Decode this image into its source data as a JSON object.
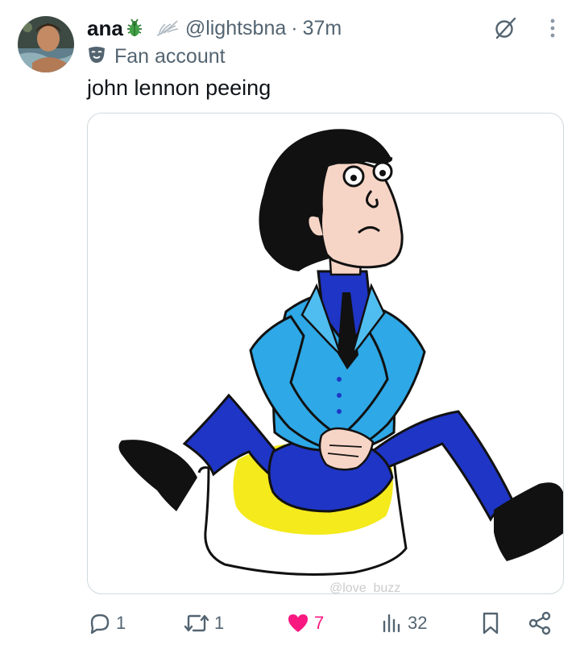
{
  "tweet": {
    "author_name": "ana",
    "name_emoji": "beetle-emoji",
    "name_icon": "wing-icon",
    "handle": "@lightsbna",
    "separator": "·",
    "time": "37m",
    "label": "Fan account",
    "label_icon": "theater-mask-icon",
    "text": "john lennon peeing",
    "media_watermark": "@love_buzz_"
  },
  "actions": {
    "replies": "1",
    "reposts": "1",
    "likes": "7",
    "views": "32"
  },
  "colors": {
    "like_active": "#f91880",
    "secondary_text": "#536471",
    "primary_text": "#0f1419",
    "border": "#cfd9de"
  }
}
